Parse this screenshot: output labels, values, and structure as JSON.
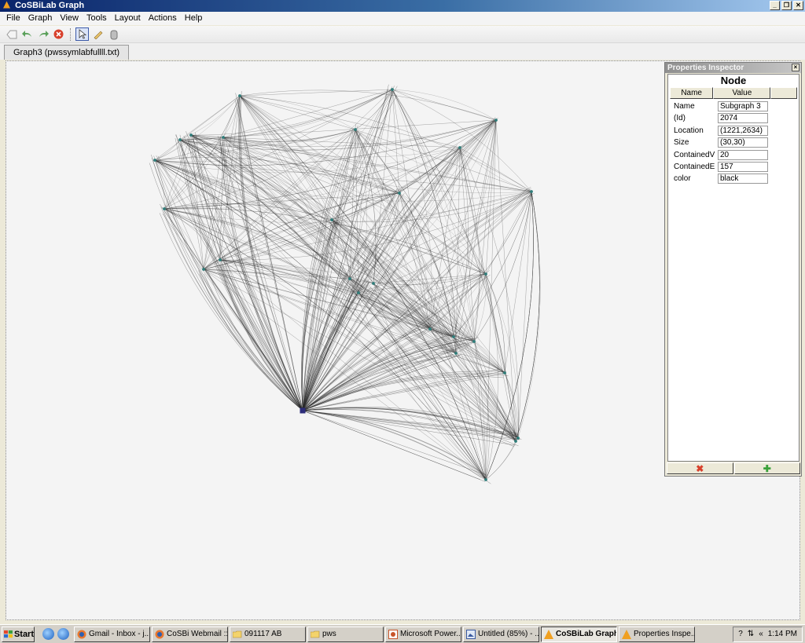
{
  "window": {
    "title": "CoSBiLab Graph",
    "controls": [
      "_",
      "❐",
      "✕"
    ]
  },
  "menu": [
    "File",
    "Graph",
    "View",
    "Tools",
    "Layout",
    "Actions",
    "Help"
  ],
  "toolbar": {
    "buttons": [
      "tag-icon",
      "undo-arrow-icon",
      "redo-arrow-icon",
      "stop-icon",
      "pointer-icon",
      "pencil-icon",
      "hand-icon"
    ],
    "selected": "pointer-icon"
  },
  "tab": {
    "label": "Graph3 (pwssymlabfullll.txt)"
  },
  "inspector": {
    "title": "Properties Inspector",
    "heading": "Node",
    "col_name": "Name",
    "col_value": "Value",
    "rows": [
      {
        "name": "Name",
        "value": "Subgraph 3"
      },
      {
        "name": "(Id)",
        "value": "2074"
      },
      {
        "name": "Location",
        "value": "(1221,2634)"
      },
      {
        "name": "Size",
        "value": "(30,30)"
      },
      {
        "name": "ContainedV",
        "value": "20"
      },
      {
        "name": "ContainedE",
        "value": "157"
      },
      {
        "name": "color",
        "value": "black"
      }
    ],
    "footer": [
      "✖",
      "✚"
    ]
  },
  "taskbar": {
    "start": "Start",
    "tasks": [
      {
        "label": "Gmail - Inbox - j...",
        "active": false
      },
      {
        "label": "CoSBi Webmail ::...",
        "active": false
      },
      {
        "label": "091117 AB",
        "active": false
      },
      {
        "label": "pws",
        "active": false
      },
      {
        "label": "Microsoft Power...",
        "active": false
      },
      {
        "label": "Untitled (85%) - ...",
        "active": false
      },
      {
        "label": "CoSBiLab Graph",
        "active": true
      },
      {
        "label": "Properties Inspe...",
        "active": false
      }
    ],
    "clock": "1:14 PM"
  },
  "colors": {
    "title_start": "#0a246a",
    "edge": "#2a2a2a",
    "node": "#2f7d7a",
    "hub": "#2c2c7a"
  }
}
